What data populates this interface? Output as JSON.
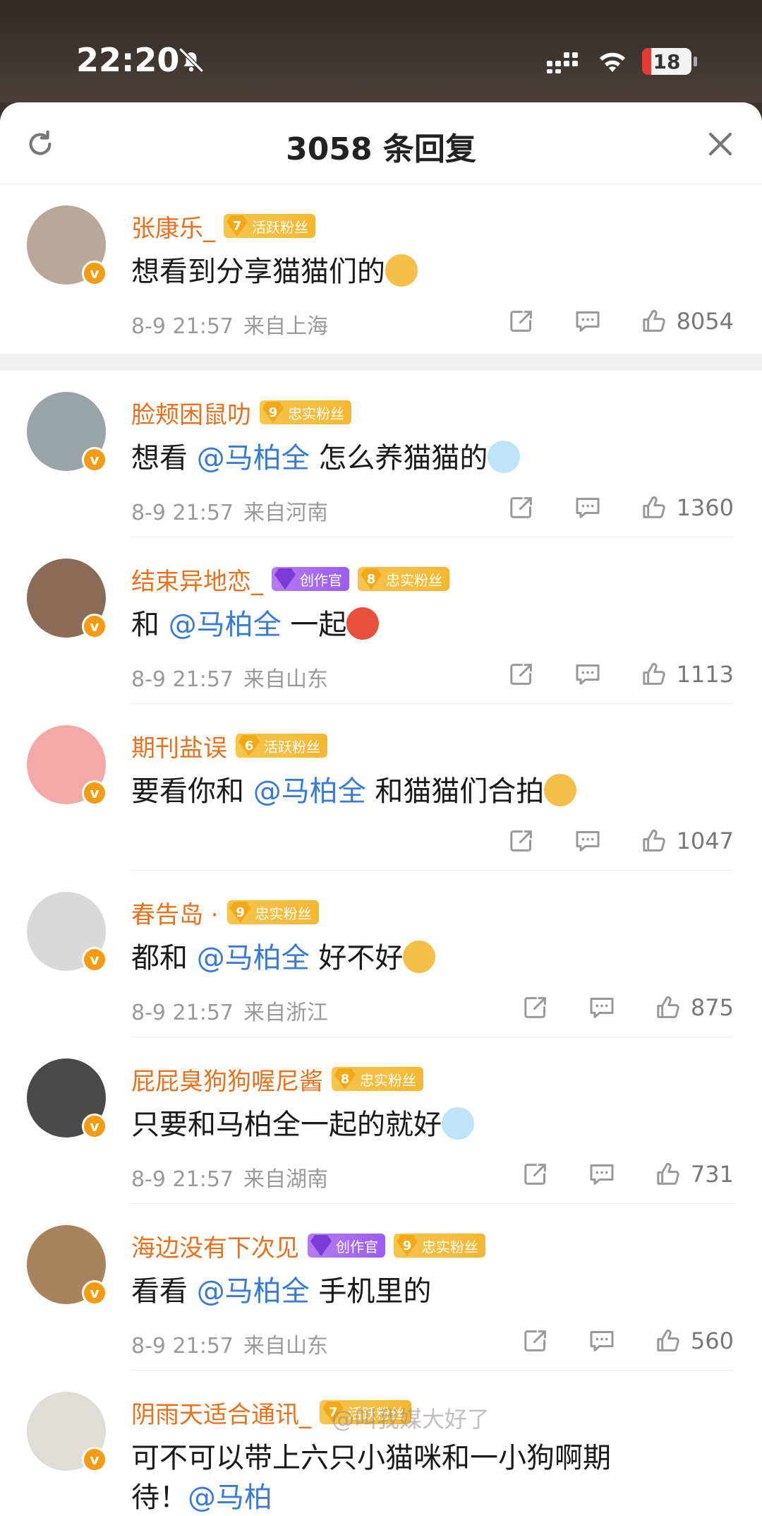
{
  "status_bar": {
    "time": "22:20",
    "battery_level": "18",
    "battery_fraction": 0.18
  },
  "header": {
    "title": "3058 条回复"
  },
  "comments": [
    {
      "username": "张康乐_",
      "badges": [
        {
          "level": "7",
          "label": "活跃粉丝",
          "style": "gold"
        }
      ],
      "text_before": "想看到分享猫猫们的",
      "mention": "",
      "text_after": "",
      "time": "8-9 21:57",
      "location": "来自上海",
      "likes": "8054",
      "avatar_color": "#b9a79a"
    },
    {
      "username": "脸颊困鼠叻",
      "badges": [
        {
          "level": "9",
          "label": "忠实粉丝",
          "style": "gold"
        }
      ],
      "text_before": "想看 ",
      "mention": "@马柏全",
      "text_after": " 怎么养猫猫的",
      "time": "8-9 21:57",
      "location": "来自河南",
      "likes": "1360",
      "avatar_color": "#9aa3a8"
    },
    {
      "username": "结束异地恋_",
      "badges": [
        {
          "level": "",
          "label": "创作官",
          "style": "purple"
        },
        {
          "level": "8",
          "label": "忠实粉丝",
          "style": "gold"
        }
      ],
      "text_before": "和 ",
      "mention": "@马柏全",
      "text_after": " 一起",
      "time": "8-9 21:57",
      "location": "来自山东",
      "likes": "1113",
      "avatar_color": "#8a6b57"
    },
    {
      "username": "期刊盐误",
      "badges": [
        {
          "level": "6",
          "label": "活跃粉丝",
          "style": "gold"
        }
      ],
      "text_before": "要看你和 ",
      "mention": "@马柏全",
      "text_after": " 和猫猫们合拍",
      "time": "",
      "location": "",
      "likes": "1047",
      "avatar_color": "#f4a9a9"
    },
    {
      "username": "春告岛 ·",
      "badges": [
        {
          "level": "9",
          "label": "忠实粉丝",
          "style": "gold"
        }
      ],
      "text_before": "都和 ",
      "mention": "@马柏全",
      "text_after": " 好不好",
      "time": "8-9 21:57",
      "location": "来自浙江",
      "likes": "875",
      "avatar_color": "#d9d9d9"
    },
    {
      "username": "屁屁臭狗狗喔尼酱",
      "badges": [
        {
          "level": "8",
          "label": "忠实粉丝",
          "style": "gold"
        }
      ],
      "text_before": "只要和马柏全一起的就好",
      "mention": "",
      "text_after": "",
      "time": "8-9 21:57",
      "location": "来自湖南",
      "likes": "731",
      "avatar_color": "#4a4a4a"
    },
    {
      "username": "海边没有下次见",
      "badges": [
        {
          "level": "",
          "label": "创作官",
          "style": "purple"
        },
        {
          "level": "9",
          "label": "忠实粉丝",
          "style": "gold"
        }
      ],
      "text_before": "看看 ",
      "mention": "@马柏全",
      "text_after": " 手机里的",
      "time": "8-9 21:57",
      "location": "来自山东",
      "likes": "560",
      "avatar_color": "#a8835e"
    },
    {
      "username": "阴雨天适合通讯_",
      "badges": [
        {
          "level": "7",
          "label": "活跃粉丝",
          "style": "gold"
        }
      ],
      "text_before": "可不可以带上六只小猫咪和一小狗啊期",
      "mention": "",
      "text_after": "",
      "line2_before": "待！",
      "line2_mention": "@马柏",
      "time": "",
      "location": "",
      "likes": "",
      "avatar_color": "#e0dcd8"
    }
  ],
  "watermark": "@叫我媒大好了",
  "icons": [
    "bell-off-icon",
    "signal-icon",
    "wifi-icon",
    "refresh-icon",
    "close-icon",
    "share-icon",
    "reply-icon",
    "like-icon",
    "verified-icon"
  ]
}
